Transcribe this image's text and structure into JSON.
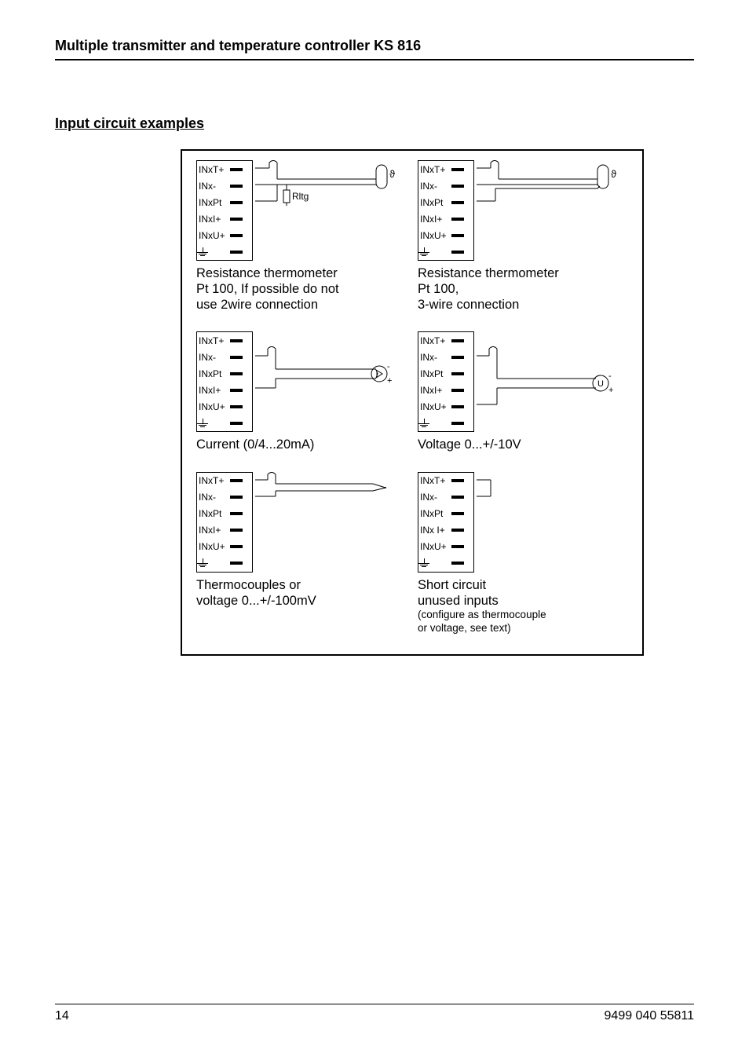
{
  "header": {
    "title": "Multiple transmitter and temperature controller KS 816"
  },
  "section": {
    "heading": "Input circuit examples"
  },
  "terminals": {
    "row1": "INxT+",
    "row2": "INx-",
    "row3": "INxPt",
    "row4": "INxI+",
    "row4b": "INx I+",
    "row5": "INxU+",
    "rltg": "Rltg"
  },
  "sensors": {
    "theta": "ϑ",
    "I": "I",
    "U": "U",
    "plus": "+",
    "minus": "-"
  },
  "captions": {
    "c1a": "Resistance thermometer",
    "c1b": "Pt 100, If possible do not",
    "c1c": "use 2wire connection",
    "c2a": "Resistance thermometer",
    "c2b": "Pt 100,",
    "c2c": "3-wire connection",
    "c3": "Current (0/4...20mA)",
    "c4": "Voltage 0...+/-10V",
    "c5a": "Thermocouples or",
    "c5b": "voltage 0...+/-100mV",
    "c6a": "Short circuit",
    "c6b": "unused inputs",
    "c6c": "(configure as thermocouple",
    "c6d": " or voltage, see text)"
  },
  "footer": {
    "page": "14",
    "docnum": "9499 040 55811"
  }
}
